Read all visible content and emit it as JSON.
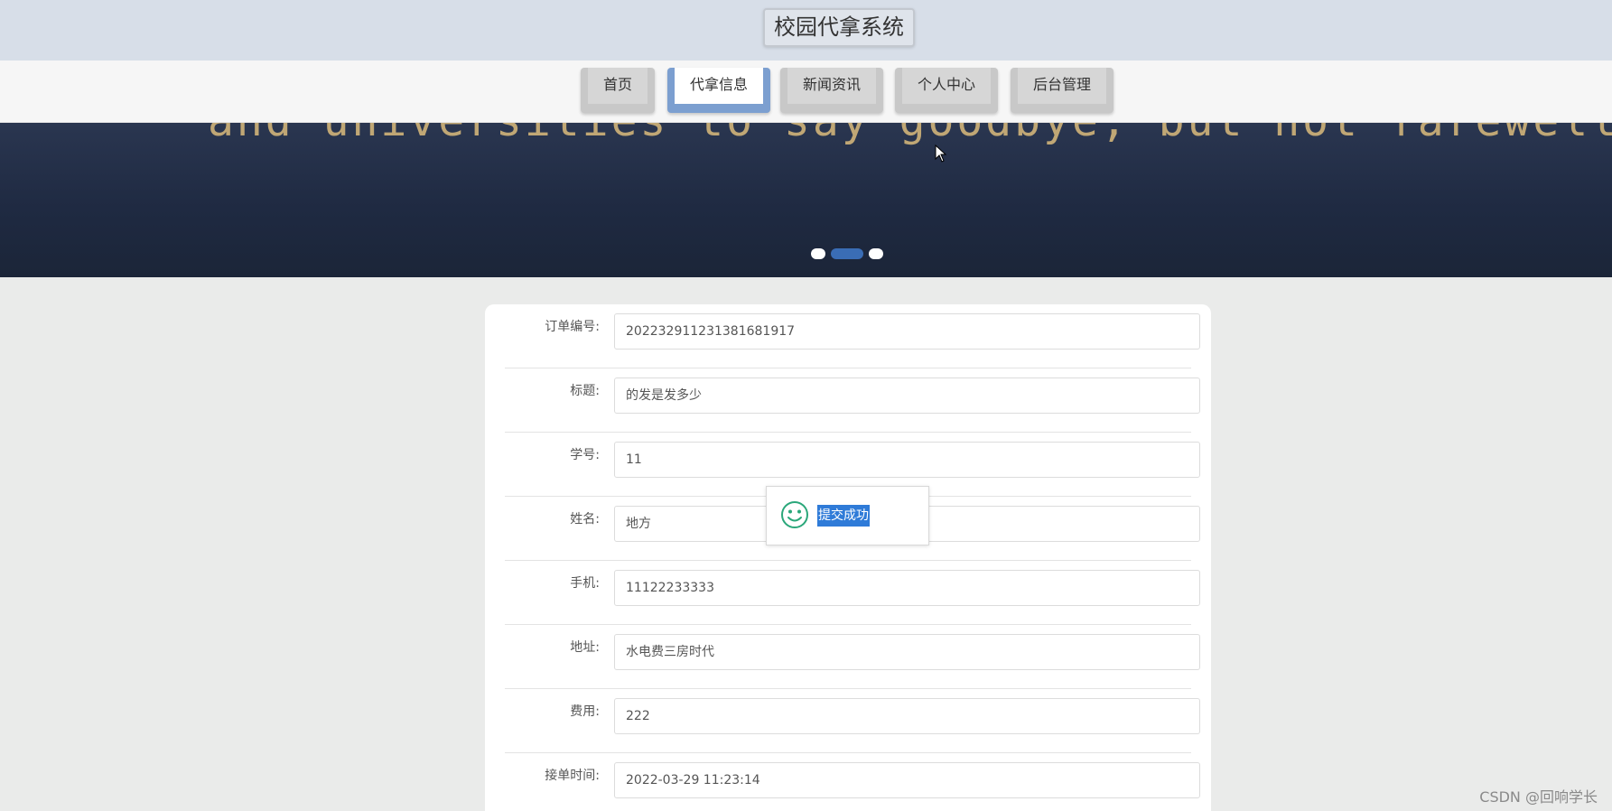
{
  "header": {
    "title": "校园代拿系统"
  },
  "nav": {
    "items": [
      {
        "label": "首页",
        "active": false
      },
      {
        "label": "代拿信息",
        "active": true
      },
      {
        "label": "新闻资讯",
        "active": false
      },
      {
        "label": "个人中心",
        "active": false
      },
      {
        "label": "后台管理",
        "active": false
      }
    ]
  },
  "banner": {
    "text": "and universities to say goodbye, but not farewell with youth",
    "slides": 3,
    "active_slide": 2
  },
  "form": {
    "fields": [
      {
        "label": "订单编号:",
        "value": "20223291123138168191​7"
      },
      {
        "label": "标题:",
        "value": "的发是发多少"
      },
      {
        "label": "学号:",
        "value": "11"
      },
      {
        "label": "姓名:",
        "value": "地方"
      },
      {
        "label": "手机:",
        "value": "11122233333"
      },
      {
        "label": "地址:",
        "value": "水电费三房时代"
      },
      {
        "label": "费用:",
        "value": "222"
      },
      {
        "label": "接单时间:",
        "value": "2022-03-29 11:23:14"
      }
    ]
  },
  "toast": {
    "message": "提交成功",
    "icon": "smile-icon"
  },
  "watermark": "CSDN @回响学长",
  "colors": {
    "accent": "#7c9fd0",
    "header_bg": "#d7dee8",
    "banner_bg": "#1f2a42",
    "toast_highlight": "#2f7bd8",
    "smile": "#2aa77a"
  }
}
